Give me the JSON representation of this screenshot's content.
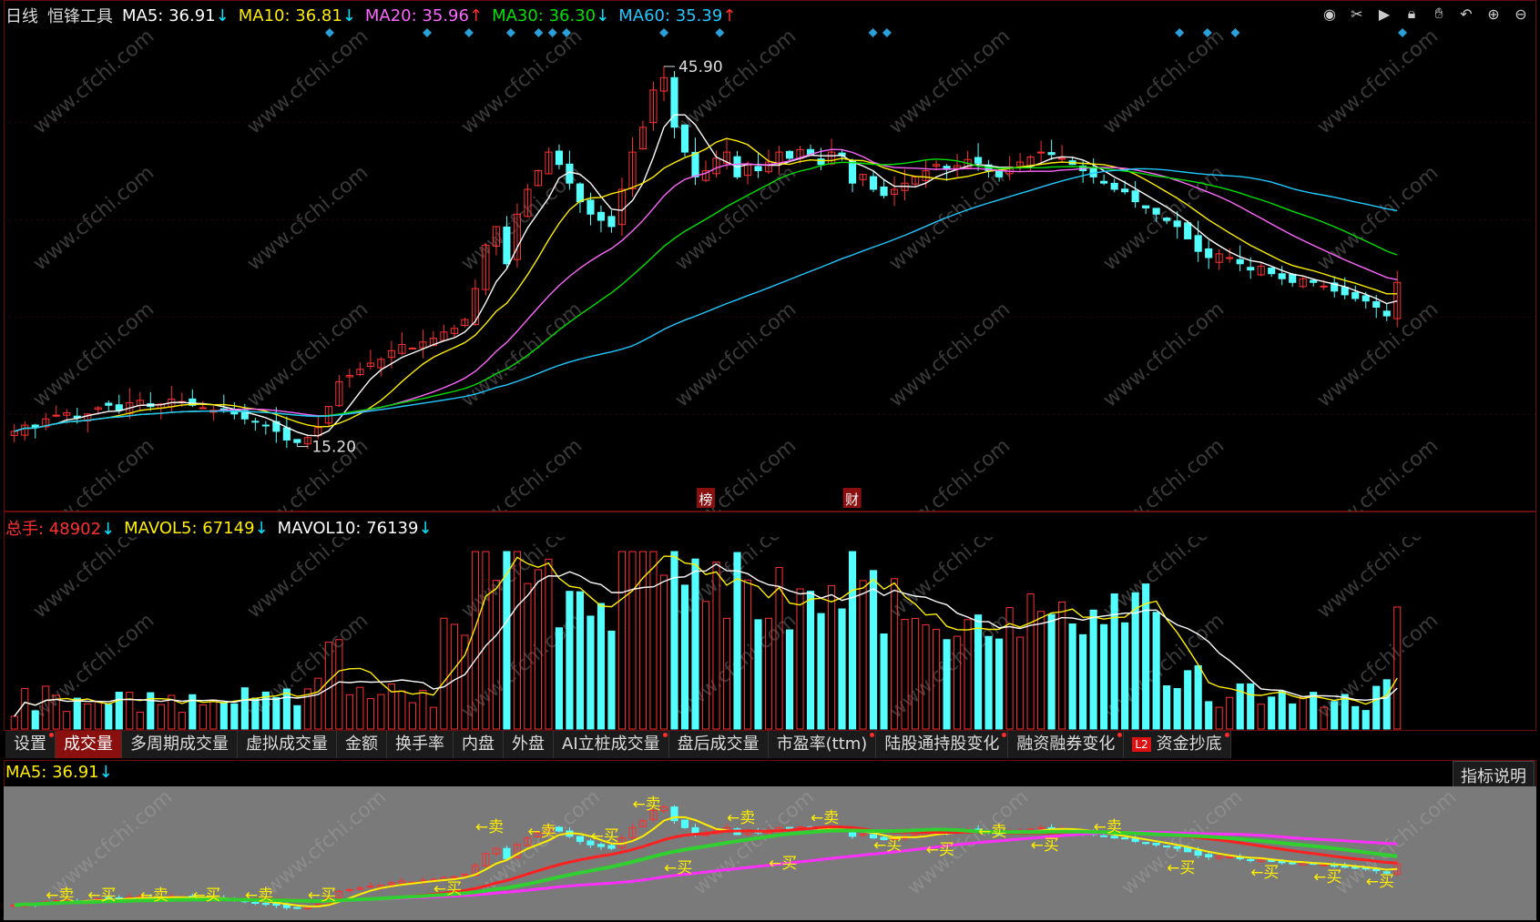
{
  "header": {
    "period": "日线",
    "stock_name": "恒锋工具",
    "ma": [
      {
        "label": "MA5: 36.91",
        "arrow": "↓",
        "color": "#ffffff",
        "arrow_color": "#00e5ff"
      },
      {
        "label": "MA10: 36.81",
        "arrow": "↓",
        "color": "#ffee00",
        "arrow_color": "#00e5ff"
      },
      {
        "label": "MA20: 35.96",
        "arrow": "↑",
        "color": "#ff66ff",
        "arrow_color": "#ff3030"
      },
      {
        "label": "MA30: 36.30",
        "arrow": "↓",
        "color": "#00e000",
        "arrow_color": "#00e5ff"
      },
      {
        "label": "MA60: 35.39",
        "arrow": "↑",
        "color": "#20c8ff",
        "arrow_color": "#ff3030"
      }
    ]
  },
  "toolbar_icons": [
    "eye-icon",
    "scissors-icon",
    "play-icon",
    "lock-icon",
    "hand-icon",
    "undo-icon",
    "zoom-in-icon",
    "zoom-out-icon"
  ],
  "price_chart": {
    "high_label": "45.90",
    "low_label": "15.20",
    "event_badges": [
      "榜",
      "财"
    ],
    "watermark": "www.cfchi.com"
  },
  "volume": {
    "total_label": "总手: 48902",
    "total_arrow": "↓",
    "mavol5_label": "MAVOL5: 67149",
    "mavol5_arrow": "↓",
    "mavol10_label": "MAVOL10: 76139",
    "mavol10_arrow": "↓"
  },
  "tabs": [
    {
      "label": "设置",
      "dot": true
    },
    {
      "label": "成交量",
      "active": true
    },
    {
      "label": "多周期成交量"
    },
    {
      "label": "虚拟成交量"
    },
    {
      "label": "金额"
    },
    {
      "label": "换手率"
    },
    {
      "label": "内盘"
    },
    {
      "label": "外盘"
    },
    {
      "label": "AI立桩成交量",
      "dot": true
    },
    {
      "label": "盘后成交量"
    },
    {
      "label": "市盈率(ttm)",
      "dot": true
    },
    {
      "label": "陆股通持股变化",
      "dot": true
    },
    {
      "label": "融资融券变化",
      "dot": true
    },
    {
      "label": "资金抄底",
      "dot": true,
      "badge": "L2"
    }
  ],
  "indicator": {
    "label": "MA5: 36.91",
    "arrow": "↓",
    "explain_button": "指标说明",
    "signal_sell": "←卖",
    "signal_buy": "←买"
  },
  "colors": {
    "up": "#ff3030",
    "down": "#54ffff",
    "ma5": "#ffffff",
    "ma10": "#ffee00",
    "ma20": "#ff66ff",
    "ma30": "#00e000",
    "ma60": "#20c8ff",
    "border": "#6b0d0d"
  },
  "chart_data": {
    "type": "candlestick",
    "title": "恒锋工具",
    "period": "日线",
    "price_range": [
      15.2,
      45.9
    ],
    "series_note": "approximate daily closes read off the chart",
    "close": [
      16.5,
      17.0,
      16.8,
      17.5,
      17.8,
      18.0,
      17.6,
      17.9,
      18.4,
      18.6,
      18.2,
      18.8,
      19.0,
      18.5,
      18.7,
      19.1,
      18.9,
      18.6,
      18.4,
      18.2,
      18.3,
      17.9,
      17.5,
      17.3,
      17.0,
      16.5,
      15.8,
      15.6,
      16.0,
      16.8,
      18.5,
      20.5,
      21.0,
      21.5,
      22.0,
      22.3,
      23.0,
      23.5,
      23.2,
      23.7,
      24.0,
      24.5,
      24.8,
      25.5,
      28.0,
      31.5,
      33.0,
      30.0,
      34.0,
      36.0,
      37.5,
      39.0,
      38.0,
      36.5,
      35.0,
      34.0,
      33.5,
      33.0,
      36.0,
      39.0,
      41.0,
      44.0,
      45.0,
      41.0,
      39.0,
      37.0,
      37.5,
      38.5,
      39.0,
      37.0,
      38.0,
      37.5,
      38.2,
      39.0,
      38.5,
      39.2,
      38.8,
      38.0,
      39.0,
      38.7,
      36.5,
      37.2,
      36.0,
      35.5,
      36.0,
      36.5,
      37.0,
      37.5,
      38.0,
      37.6,
      37.9,
      38.4,
      38.1,
      37.5,
      37.0,
      37.8,
      38.2,
      38.6,
      39.0,
      38.8,
      38.5,
      38.0,
      37.5,
      37.0,
      36.5,
      36.0,
      35.8,
      35.0,
      34.5,
      34.0,
      33.5,
      33.0,
      32.0,
      31.0,
      30.5,
      30.8,
      30.5,
      30.0,
      29.5,
      29.8,
      29.2,
      28.8,
      28.5,
      28.8,
      28.5,
      28.2,
      27.8,
      27.5,
      27.2,
      27.0,
      26.5,
      25.8,
      28.5
    ],
    "ma": {
      "MA5": 36.91,
      "MA10": 36.81,
      "MA20": 35.96,
      "MA30": 36.3,
      "MA60": 35.39
    },
    "volume": {
      "total": 48902,
      "MAVOL5": 67149,
      "MAVOL10": 76139
    }
  }
}
